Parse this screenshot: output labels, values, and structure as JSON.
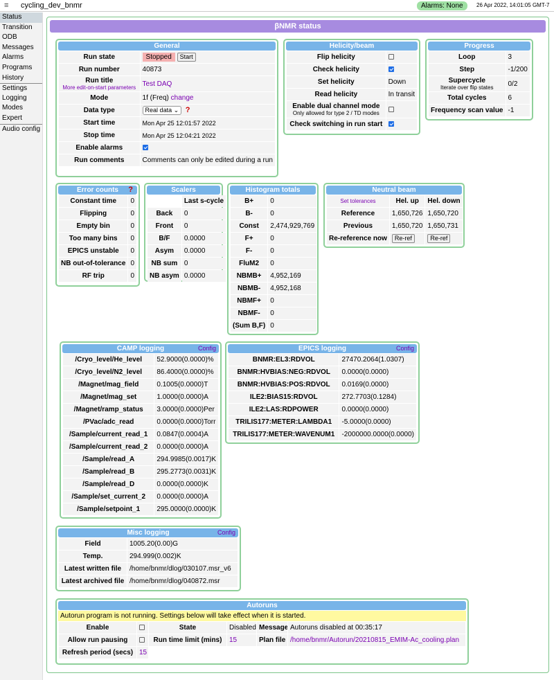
{
  "app": {
    "title": "cycling_dev_bnmr",
    "menu_icon": "≡",
    "alarms": "Alarms: None",
    "clock": "26 Apr 2022, 14:01:05 GMT-7"
  },
  "nav": [
    "Status",
    "Transition",
    "ODB",
    "Messages",
    "Alarms",
    "Programs",
    "History",
    "Settings",
    "Logging",
    "Modes",
    "Expert",
    "Audio config"
  ],
  "page": {
    "title": "βNMR status"
  },
  "general": {
    "title": "General",
    "run_state_label": "Run state",
    "run_state": "Stopped",
    "start_btn": "Start",
    "run_number_label": "Run number",
    "run_number": "40873",
    "run_title_label": "Run title",
    "run_title_sub": "More edit-on-start parameters",
    "run_title": "Test DAQ",
    "mode_label": "Mode",
    "mode": "1f (Freq)",
    "mode_change": "change",
    "data_type_label": "Data type",
    "data_type": "Real data",
    "start_time_label": "Start time",
    "start_time": "Mon Apr 25 12:01:57 2022",
    "stop_time_label": "Stop time",
    "stop_time": "Mon Apr 25 12:04:21 2022",
    "alarms_label": "Enable alarms",
    "comments_label": "Run comments",
    "comments": "Comments can only be edited during a run",
    "help": "?"
  },
  "helicity": {
    "title": "Helicity/beam",
    "flip": "Flip helicity",
    "check": "Check helicity",
    "set": "Set helicity",
    "set_val": "Down",
    "read": "Read helicity",
    "read_val": "In transit",
    "dual": "Enable dual channel mode",
    "dual_sub": "Only allowed for type 2 / TD modes",
    "switch": "Check switching in run start"
  },
  "progress": {
    "title": "Progress",
    "loop": "Loop",
    "loop_val": "3",
    "step": "Step",
    "step_val": "-1/200",
    "supercycle": "Supercycle",
    "supercycle_sub": "Iterate over flip states",
    "supercycle_val": "0/2",
    "total": "Total cycles",
    "total_val": "6",
    "freq": "Frequency scan value",
    "freq_val": "-1"
  },
  "errors": {
    "title": "Error counts",
    "rows": [
      [
        "Constant time",
        "0"
      ],
      [
        "Flipping",
        "0"
      ],
      [
        "Empty bin",
        "0"
      ],
      [
        "Too many bins",
        "0"
      ],
      [
        "EPICS unstable",
        "0"
      ],
      [
        "NB out-of-tolerance",
        "0"
      ],
      [
        "RF trip",
        "0"
      ]
    ]
  },
  "scalers": {
    "title": "Scalers",
    "col": "Last s-cycle",
    "rows": [
      [
        "Back",
        "0"
      ],
      [
        "Front",
        "0"
      ],
      [
        "B/F",
        "0.0000"
      ],
      [
        "Asym",
        "0.0000"
      ],
      [
        "NB sum",
        "0"
      ],
      [
        "NB asym",
        "0.0000"
      ]
    ]
  },
  "histograms": {
    "title": "Histogram totals",
    "rows": [
      [
        "B+",
        "0"
      ],
      [
        "B-",
        "0"
      ],
      [
        "Const",
        "2,474,929,769"
      ],
      [
        "F+",
        "0"
      ],
      [
        "F-",
        "0"
      ],
      [
        "FluM2",
        "0"
      ],
      [
        "NBMB+",
        "4,952,169"
      ],
      [
        "NBMB-",
        "4,952,168"
      ],
      [
        "NBMF+",
        "0"
      ],
      [
        "NBMF-",
        "0"
      ],
      [
        "(Sum B,F)",
        "0"
      ]
    ]
  },
  "neutral": {
    "title": "Neutral beam",
    "set_tol": "Set tolerances",
    "col_up": "Hel. up",
    "col_down": "Hel. down",
    "ref": "Reference",
    "ref_up": "1,650,726",
    "ref_down": "1,650,720",
    "prev": "Previous",
    "prev_up": "1,650,720",
    "prev_down": "1,650,731",
    "reref": "Re-reference now",
    "reref_btn": "Re-ref"
  },
  "camp": {
    "title": "CAMP logging",
    "config": "Config",
    "rows": [
      [
        "/Cryo_level/He_level",
        "52.9000(0.0000)%"
      ],
      [
        "/Cryo_level/N2_level",
        "86.4000(0.0000)%"
      ],
      [
        "/Magnet/mag_field",
        "0.1005(0.0000)T"
      ],
      [
        "/Magnet/mag_set",
        "1.0000(0.0000)A"
      ],
      [
        "/Magnet/ramp_status",
        "3.0000(0.0000)Per"
      ],
      [
        "/PVac/adc_read",
        "0.0000(0.0000)Torr"
      ],
      [
        "/Sample/current_read_1",
        "0.0847(0.0004)A"
      ],
      [
        "/Sample/current_read_2",
        "0.0000(0.0000)A"
      ],
      [
        "/Sample/read_A",
        "294.9985(0.0017)K"
      ],
      [
        "/Sample/read_B",
        "295.2773(0.0031)K"
      ],
      [
        "/Sample/read_D",
        "0.0000(0.0000)K"
      ],
      [
        "/Sample/set_current_2",
        "0.0000(0.0000)A"
      ],
      [
        "/Sample/setpoint_1",
        "295.0000(0.0000)K"
      ]
    ]
  },
  "epics": {
    "title": "EPICS logging",
    "config": "Config",
    "rows": [
      [
        "BNMR:EL3:RDVOL",
        "27470.2064(1.0307)"
      ],
      [
        "BNMR:HVBIAS:NEG:RDVOL",
        "0.0000(0.0000)"
      ],
      [
        "BNMR:HVBIAS:POS:RDVOL",
        "0.0169(0.0000)"
      ],
      [
        "ILE2:BIAS15:RDVOL",
        "272.7703(0.1284)"
      ],
      [
        "ILE2:LAS:RDPOWER",
        "0.0000(0.0000)"
      ],
      [
        "TRILIS177:METER:LAMBDA1",
        "-5.0000(0.0000)"
      ],
      [
        "TRILIS177:METER:WAVENUM1",
        "-2000000.0000(0.0000)"
      ]
    ]
  },
  "misc": {
    "title": "Misc logging",
    "config": "Config",
    "rows": [
      [
        "Field",
        "1005.20(0.00)G"
      ],
      [
        "Temp.",
        "294.999(0.002)K"
      ],
      [
        "Latest written file",
        "/home/bnmr/dlog/030107.msr_v6"
      ],
      [
        "Latest archived file",
        "/home/bnmr/dlog/040872.msr"
      ]
    ]
  },
  "autoruns": {
    "title": "Autoruns",
    "banner": "Autorun program is not running. Settings below will take effect when it is started.",
    "enable": "Enable",
    "state": "State",
    "state_val": "Disabled",
    "message": "Message",
    "message_val": "Autoruns disabled at 00:35:17",
    "pausing": "Allow run pausing",
    "time_limit": "Run time limit (mins)",
    "time_limit_val": "15",
    "plan": "Plan file",
    "plan_val": "/home/bnmr/Autorun/20210815_EMIM-Ac_cooling.plan",
    "refresh": "Refresh period (secs)",
    "refresh_val": "15"
  }
}
